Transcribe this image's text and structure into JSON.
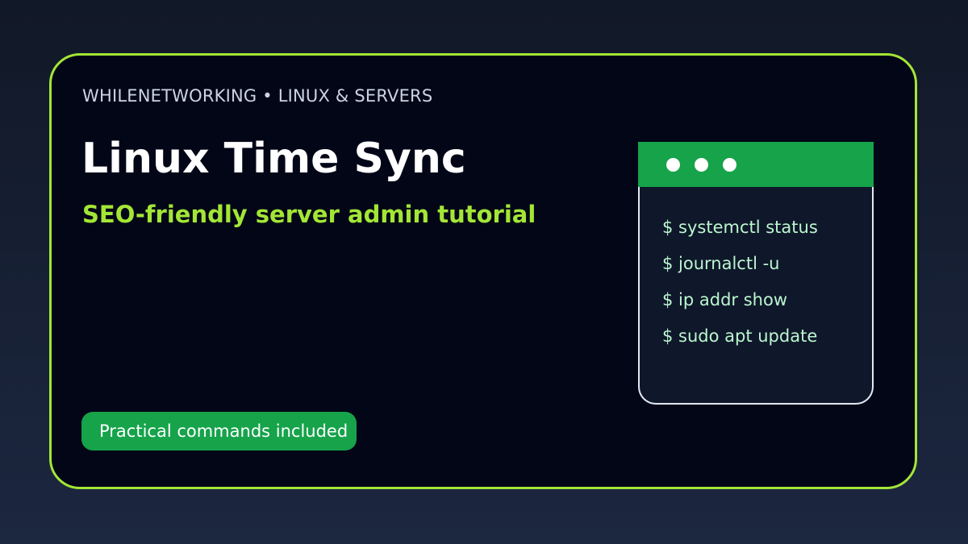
{
  "card": {
    "eyebrow": "WHILENETWORKING • LINUX & SERVERS",
    "title": "Linux Time Sync",
    "subtitle": "SEO-friendly server admin tutorial",
    "badge": "Practical commands included"
  },
  "terminal": {
    "window_dots": [
      "dot-icon",
      "dot-icon",
      "dot-icon"
    ],
    "lines": [
      "$ systemctl status",
      "$ journalctl -u",
      "$ ip addr show",
      "$ sudo apt update"
    ]
  },
  "colors": {
    "accent": "#a3e635",
    "brand_green": "#16a34a",
    "card_bg": "#020617",
    "terminal_text": "#bbf7d0"
  }
}
